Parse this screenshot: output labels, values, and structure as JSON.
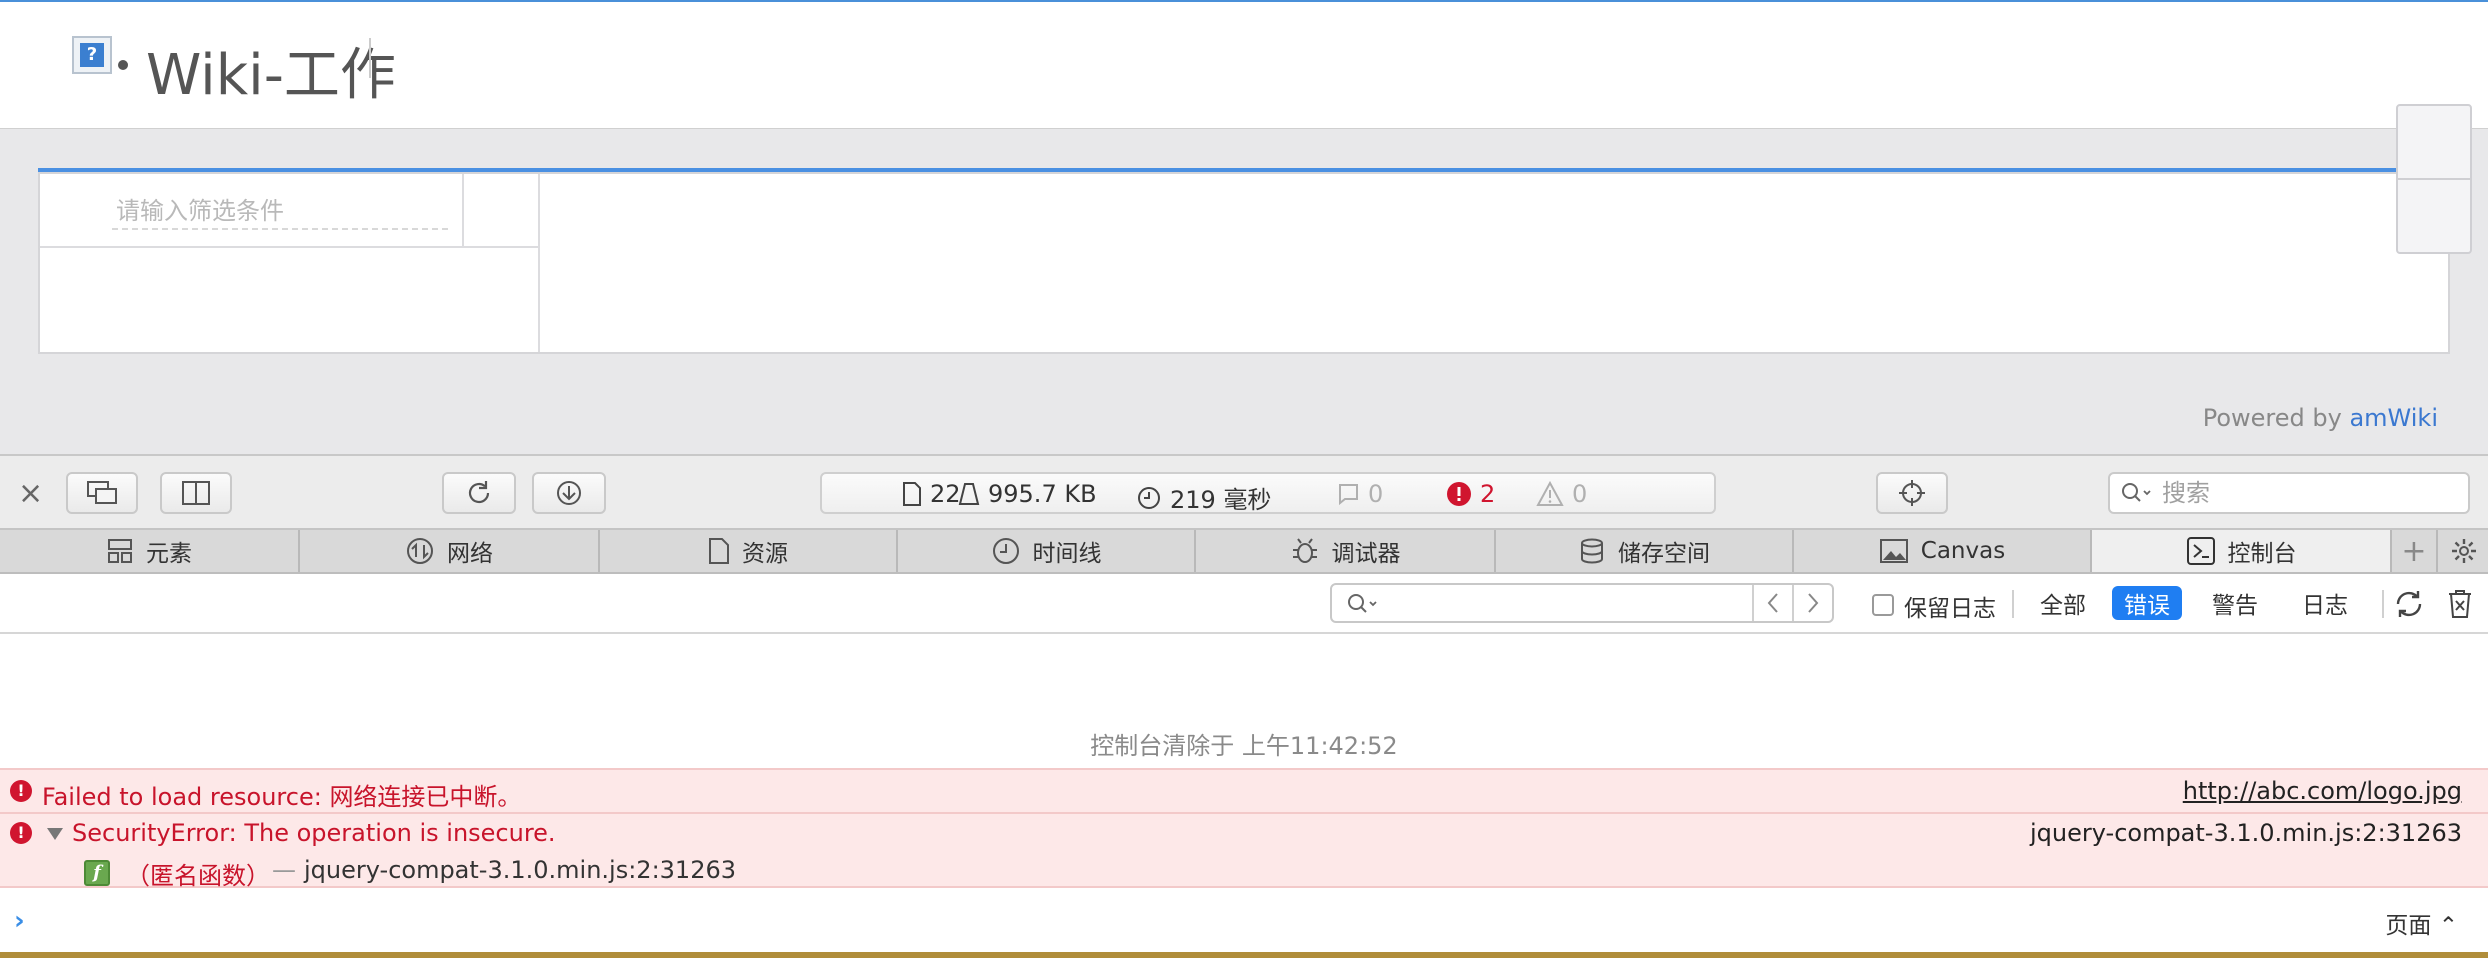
{
  "page": {
    "title": "Wiki-工作",
    "filter_placeholder": "请输入筛选条件",
    "powered_by_prefix": "Powered by ",
    "powered_by_link": "amWiki"
  },
  "toolbar": {
    "close_label": "×",
    "resources_count": "22",
    "transfer_size": "995.7 KB",
    "load_time": "219 毫秒",
    "log_count": "0",
    "error_count": "2",
    "warning_count": "0",
    "search_placeholder": "搜索"
  },
  "tabs": [
    {
      "label": "元素",
      "icon": "elements-icon"
    },
    {
      "label": "网络",
      "icon": "network-icon"
    },
    {
      "label": "资源",
      "icon": "resources-icon"
    },
    {
      "label": "时间线",
      "icon": "timeline-icon"
    },
    {
      "label": "调试器",
      "icon": "debugger-icon"
    },
    {
      "label": "储存空间",
      "icon": "storage-icon"
    },
    {
      "label": "Canvas",
      "icon": "canvas-icon"
    },
    {
      "label": "控制台",
      "icon": "console-icon",
      "active": true
    }
  ],
  "console_filter": {
    "search_value": "",
    "preserve_log_label": "保留日志",
    "preserve_log_checked": false,
    "levels": [
      "全部",
      "错误",
      "警告",
      "日志"
    ],
    "active_level": "错误"
  },
  "console": {
    "cleared_message": "控制台清除于 上午11:42:52",
    "messages": [
      {
        "level": "error",
        "text": "Failed to load resource: 网络连接已中断。",
        "source": "http://abc.com/logo.jpg"
      },
      {
        "level": "error",
        "text": "SecurityError: The operation is insecure.",
        "source": "jquery-compat-3.1.0.min.js:2:31263",
        "stack_function": "（匿名函数）",
        "stack_separator": "—",
        "stack_location": "jquery-compat-3.1.0.min.js:2:31263"
      }
    ],
    "prompt_value": "",
    "page_selector": "页面 ⌃"
  },
  "colors": {
    "accent": "#1f7ef2",
    "error_text": "#c8142b",
    "error_bg": "#fde8e8",
    "link": "#3b78d0"
  }
}
